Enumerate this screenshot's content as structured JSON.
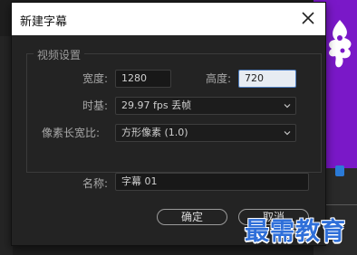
{
  "dialog": {
    "title": "新建字幕",
    "group_label": "视频设置",
    "width_label": "宽度:",
    "width_value": "1280",
    "height_label": "高度:",
    "height_value": "720",
    "timebase_label": "时基:",
    "timebase_value": "29.97 fps 丢帧",
    "pixel_aspect_label": "像素长宽比:",
    "pixel_aspect_value": "方形像素 (1.0)",
    "name_label": "名称:",
    "name_value": "字幕 01",
    "ok_label": "确定",
    "cancel_label": "取消"
  },
  "watermark": "最需教育",
  "colors": {
    "background_accent": "#7a18c8",
    "focus_border": "#4e7ec0",
    "watermark": "#2f6fd9"
  }
}
